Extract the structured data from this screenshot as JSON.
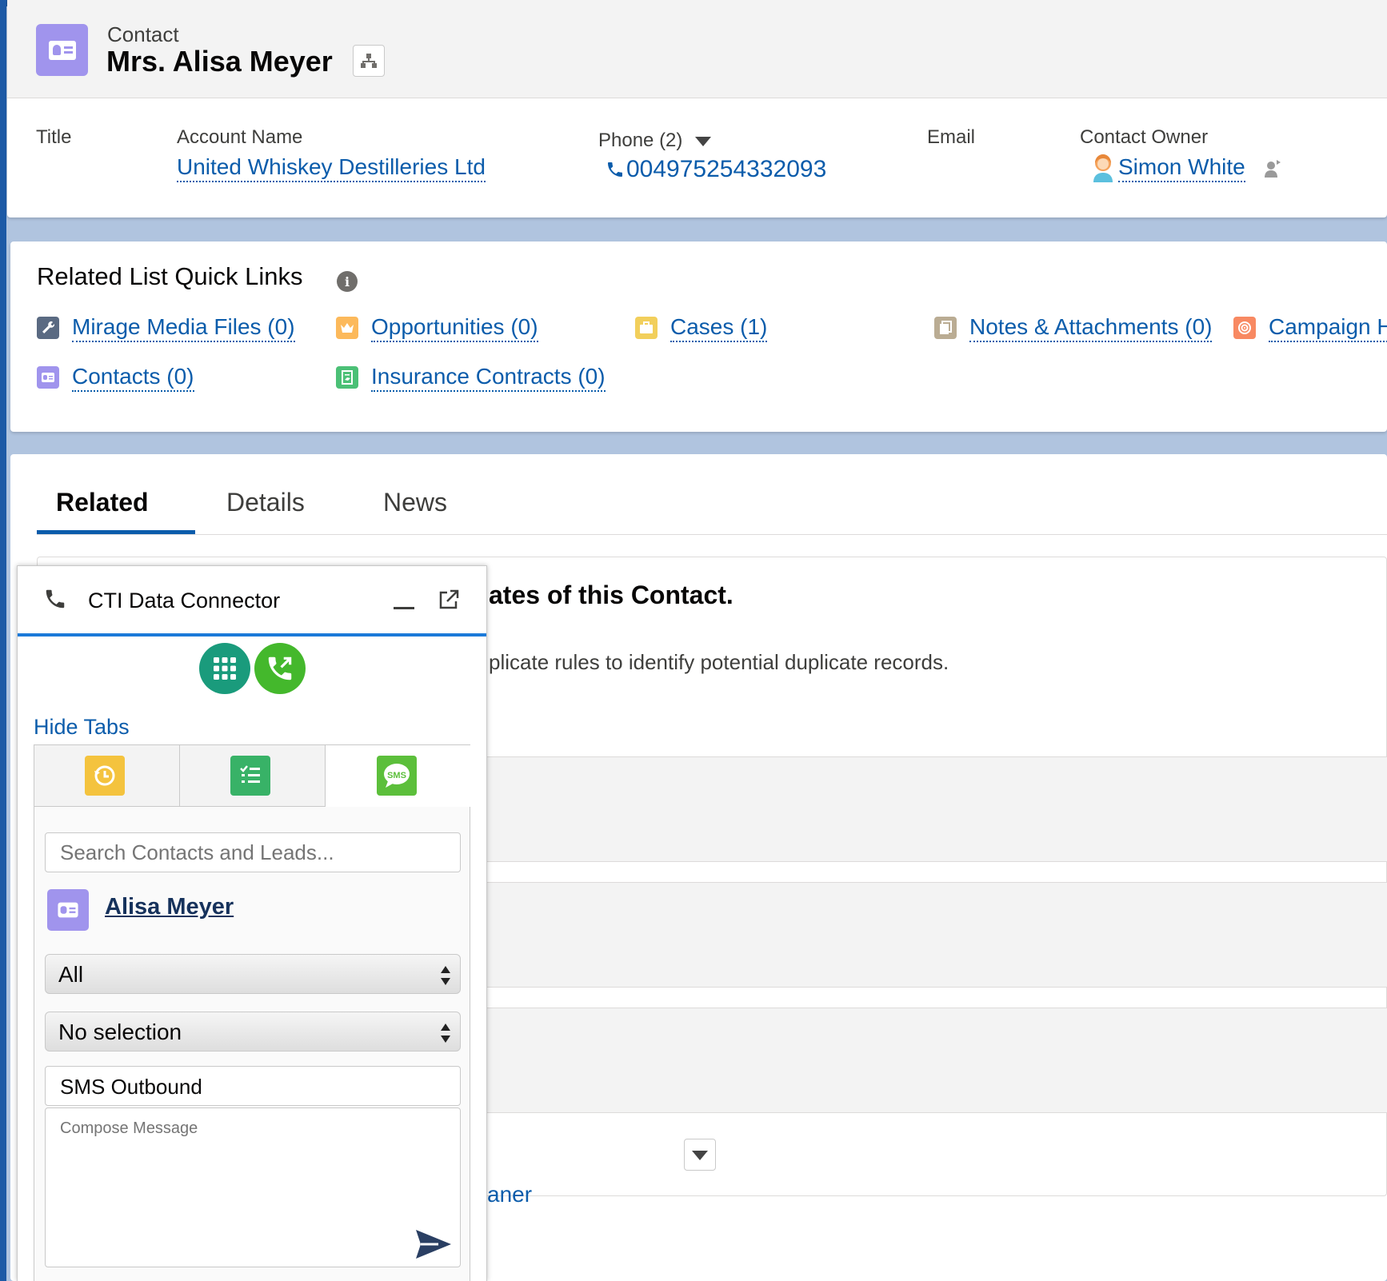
{
  "header": {
    "record_type": "Contact",
    "record_name": "Mrs. Alisa Meyer",
    "fields": {
      "title_label": "Title",
      "account_label": "Account Name",
      "account_value": "United Whiskey Destilleries Ltd",
      "phone_label": "Phone (2)",
      "phone_value": "004975254332093",
      "email_label": "Email",
      "owner_label": "Contact Owner",
      "owner_value": "Simon White"
    }
  },
  "quick_links": {
    "title": "Related List Quick Links",
    "items": [
      {
        "label": "Mirage Media Files (0)",
        "icon": "wrench-icon",
        "color": "#5a6a82"
      },
      {
        "label": "Opportunities (0)",
        "icon": "crown-icon",
        "color": "#fcb95b"
      },
      {
        "label": "Cases (1)",
        "icon": "briefcase-icon",
        "color": "#f2cf5b"
      },
      {
        "label": "Notes & Attachments (0)",
        "icon": "document-icon",
        "color": "#baac93"
      },
      {
        "label": "Campaign H",
        "icon": "target-icon",
        "color": "#f88962"
      },
      {
        "label": "Contacts (0)",
        "icon": "contact-card-icon",
        "color": "#a094ed"
      },
      {
        "label": "Insurance Contracts (0)",
        "icon": "contract-icon",
        "color": "#4bc076"
      }
    ]
  },
  "tabs": {
    "items": [
      "Related",
      "Details",
      "News"
    ],
    "active": "Related"
  },
  "duplicates": {
    "heading_partial": "ates of this Contact.",
    "subtext_partial": "plicate rules to identify potential duplicate records.",
    "partial_link": "aner"
  },
  "cti": {
    "title": "CTI Data Connector",
    "hide_tabs": "Hide Tabs",
    "search_placeholder": "Search Contacts and Leads...",
    "contact_name": "Alisa Meyer",
    "filter_value": "All",
    "template_value": "No selection",
    "message_type": "SMS Outbound",
    "compose_placeholder": "Compose Message",
    "sms_icon_text": "SMS",
    "colors": {
      "dialpad": "#1a9b7c",
      "call": "#44b82c",
      "history_tab": "#f4c33e",
      "tasks_tab": "#38b267",
      "sms_tab": "#5cbf3b",
      "accent": "#1b7ad9"
    }
  },
  "colors": {
    "link": "#0b5cab",
    "contact_icon": "#a094ed",
    "background": "#b0c4df"
  }
}
